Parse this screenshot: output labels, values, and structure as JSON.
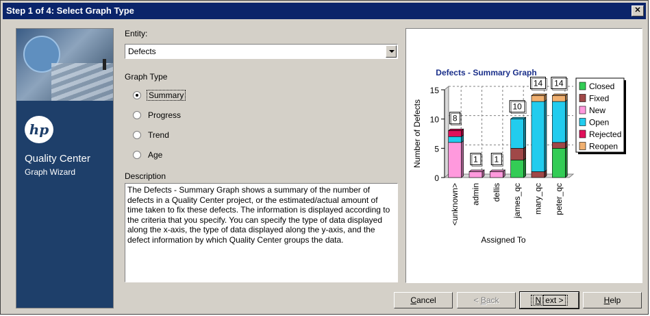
{
  "window": {
    "title": "Step 1 of 4: Select Graph Type",
    "close_glyph": "✕"
  },
  "banner": {
    "logo_text": "hp",
    "product": "Quality Center",
    "subtitle": "Graph Wizard"
  },
  "entity": {
    "label": "Entity:",
    "value": "Defects"
  },
  "graph_type": {
    "label": "Graph Type",
    "options": [
      "Summary",
      "Progress",
      "Trend",
      "Age"
    ],
    "selected": "Summary"
  },
  "description": {
    "label": "Description",
    "text": "The Defects - Summary Graph shows a summary of the number of defects in a Quality Center project, or the estimated/actual amount of time taken to fix these defects. The information is displayed according to the criteria that you specify. You can specify the type of data displayed along the x-axis, the type of data displayed along the y-axis, and the defect information by which Quality Center groups the data."
  },
  "buttons": {
    "cancel": {
      "mnemonic": "C",
      "rest": "ancel"
    },
    "back": {
      "pre": "< ",
      "mnemonic": "B",
      "rest": "ack"
    },
    "next": {
      "mnemonic": "N",
      "rest": "ext >"
    },
    "help": {
      "mnemonic": "H",
      "rest": "elp"
    }
  },
  "chart_data": {
    "type": "bar",
    "stacked": true,
    "title": "Defects - Summary Graph",
    "xlabel": "Assigned To",
    "ylabel": "Number of Defects",
    "ylim": [
      0,
      15
    ],
    "yticks": [
      0,
      5,
      10,
      15
    ],
    "categories": [
      "<unknown>",
      "admin",
      "dellis",
      "james_qc",
      "mary_qc",
      "peter_qc"
    ],
    "totals": [
      8,
      1,
      1,
      10,
      14,
      14
    ],
    "series": [
      {
        "name": "Closed",
        "color": "#33cc55",
        "values": [
          0,
          0,
          0,
          3,
          0,
          5
        ]
      },
      {
        "name": "Fixed",
        "color": "#a04848",
        "values": [
          0,
          0,
          0,
          2,
          1,
          1
        ]
      },
      {
        "name": "New",
        "color": "#ff99dd",
        "values": [
          6,
          1,
          1,
          0,
          0,
          0
        ]
      },
      {
        "name": "Open",
        "color": "#22ccee",
        "values": [
          1,
          0,
          0,
          5,
          12,
          7
        ]
      },
      {
        "name": "Rejected",
        "color": "#e0105a",
        "values": [
          1,
          0,
          0,
          0,
          0,
          0
        ]
      },
      {
        "name": "Reopen",
        "color": "#f0b070",
        "values": [
          0,
          0,
          0,
          0,
          1,
          1
        ]
      }
    ],
    "legend_position": "right"
  }
}
